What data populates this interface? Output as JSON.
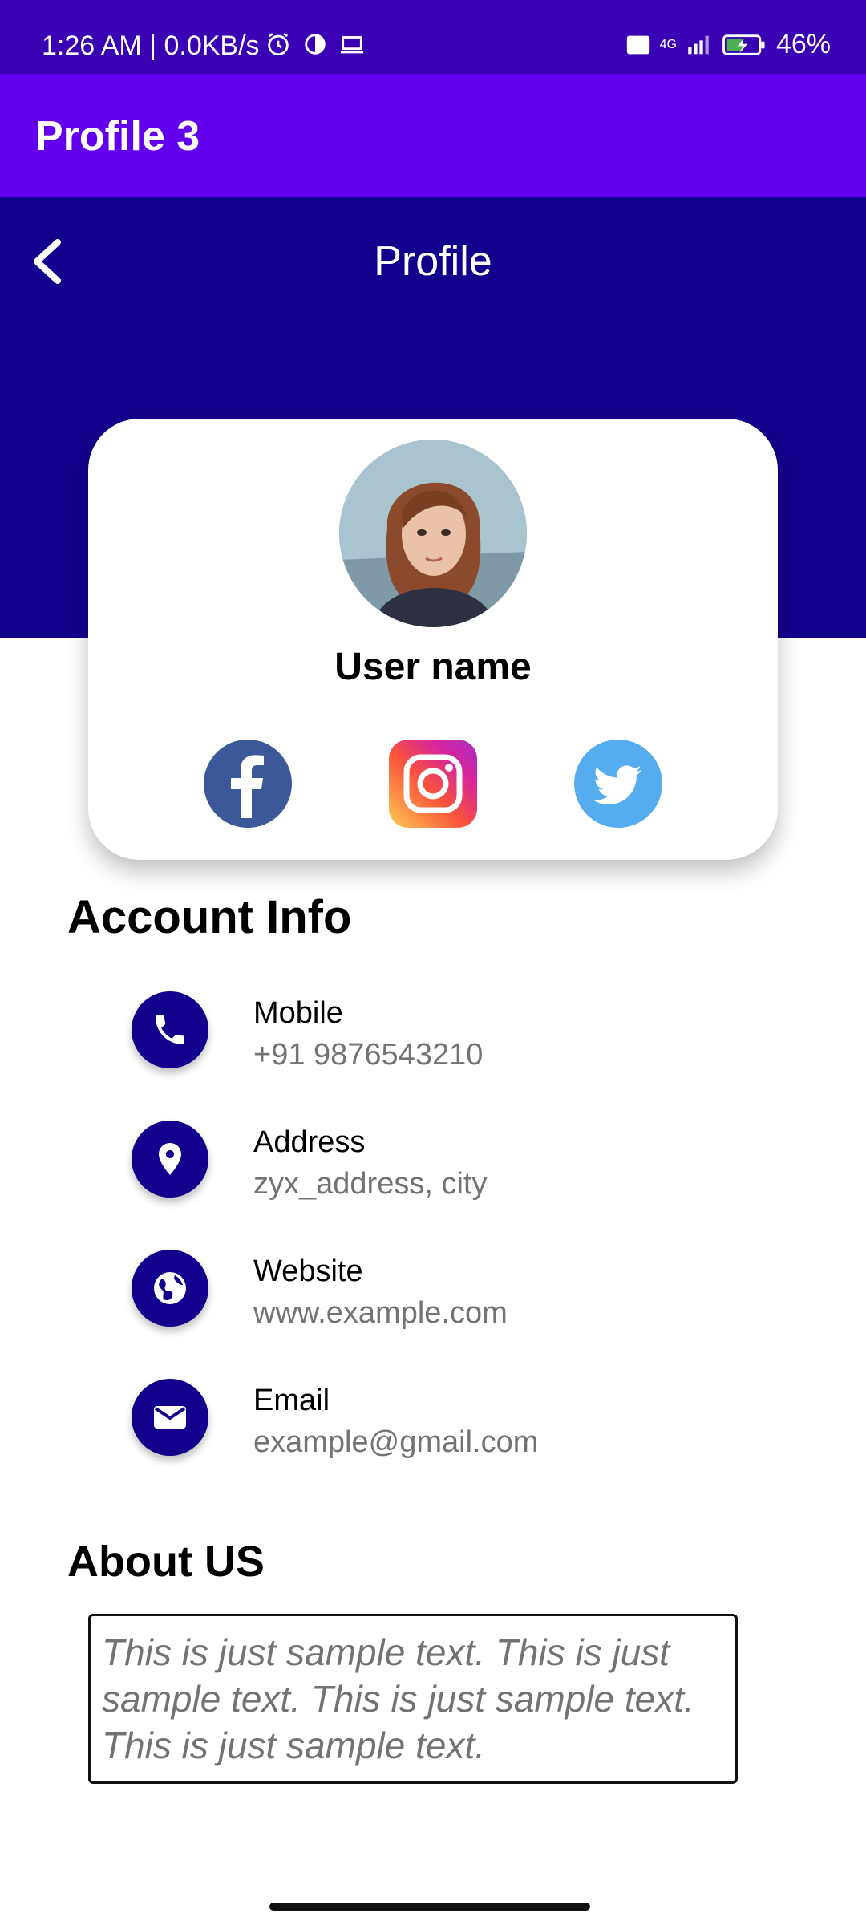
{
  "status_bar": {
    "time": "1:26 AM | 0.0KB/s",
    "network": "4G",
    "battery": "46%"
  },
  "app_bar": {
    "title": "Profile 3"
  },
  "header": {
    "title": "Profile"
  },
  "profile": {
    "username": "User name",
    "social": [
      "facebook",
      "instagram",
      "twitter"
    ]
  },
  "account_info": {
    "title": "Account Info",
    "items": [
      {
        "label": "Mobile",
        "value": "+91 9876543210",
        "icon": "phone-icon"
      },
      {
        "label": "Address",
        "value": "zyx_address, city",
        "icon": "location-pin-icon"
      },
      {
        "label": "Website",
        "value": "www.example.com",
        "icon": "globe-icon"
      },
      {
        "label": "Email",
        "value": "example@gmail.com",
        "icon": "mail-icon"
      }
    ]
  },
  "about": {
    "title": "About US",
    "text": "This is just sample text. This is just sample text. This is just sample text. This is just sample text."
  },
  "colors": {
    "status_bar": "#3a00b3",
    "app_bar": "#6200ee",
    "header": "#12008c",
    "icon_circle": "#12008c"
  }
}
